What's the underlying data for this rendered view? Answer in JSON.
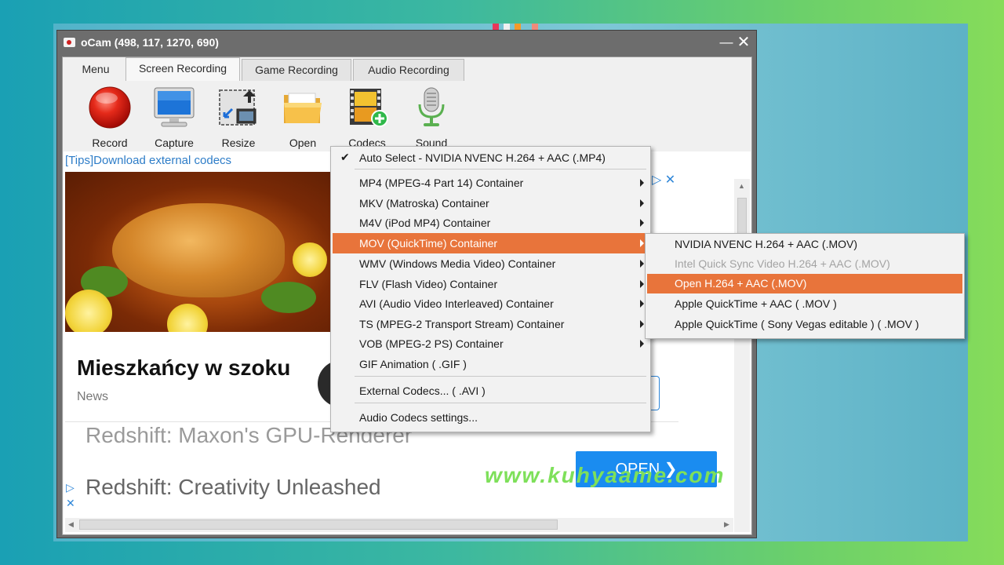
{
  "window": {
    "title": "oCam (498, 117, 1270, 690)",
    "minimize_glyph": "—",
    "close_glyph": "✕"
  },
  "tabs": [
    {
      "label": "Menu"
    },
    {
      "label": "Screen Recording"
    },
    {
      "label": "Game Recording"
    },
    {
      "label": "Audio Recording"
    }
  ],
  "toolbar": {
    "record": "Record",
    "capture": "Capture",
    "resize": "Resize",
    "open": "Open",
    "codecs": "Codecs",
    "sound": "Sound"
  },
  "content": {
    "tips_link": "[Tips]Download external codecs",
    "ad_title": "Mieszkańcy w szoku",
    "ad_source": "News",
    "ad_text_1": "Redshift: Maxon's GPU-Renderer",
    "ad_text_2": "Redshift: Creativity Unleashed",
    "open_button": "OPEN ❯",
    "ad_choices_glyph": "▷",
    "ad_close_glyph": "✕",
    "watermark": "www.kuhyaame.com"
  },
  "codec_menu": {
    "items": [
      {
        "label": "Auto Select - NVIDIA NVENC H.264 + AAC (.MP4)",
        "checked": "✔"
      },
      {
        "label": "MP4 (MPEG-4 Part 14) Container"
      },
      {
        "label": "MKV (Matroska) Container"
      },
      {
        "label": "M4V (iPod MP4) Container"
      },
      {
        "label": "MOV (QuickTime) Container"
      },
      {
        "label": "WMV (Windows Media Video) Container"
      },
      {
        "label": "FLV (Flash Video) Container"
      },
      {
        "label": "AVI (Audio Video Interleaved) Container"
      },
      {
        "label": "TS (MPEG-2 Transport Stream) Container"
      },
      {
        "label": "VOB (MPEG-2 PS) Container"
      },
      {
        "label": "GIF Animation ( .GIF )"
      },
      {
        "label": "External Codecs... ( .AVI )"
      },
      {
        "label": "Audio Codecs settings..."
      }
    ]
  },
  "mov_submenu": {
    "items": [
      {
        "label": "NVIDIA NVENC H.264 + AAC (.MOV)"
      },
      {
        "label": "Intel Quick Sync Video H.264 + AAC (.MOV)"
      },
      {
        "label": "Open H.264 + AAC (.MOV)"
      },
      {
        "label": "Apple QuickTime + AAC ( .MOV )"
      },
      {
        "label": "Apple QuickTime ( Sony Vegas editable ) ( .MOV )"
      }
    ]
  },
  "colors": {
    "highlight": "#e8743b",
    "link": "#2e7dc8",
    "open_button": "#1a8cf0",
    "watermark": "#7ee05a"
  }
}
